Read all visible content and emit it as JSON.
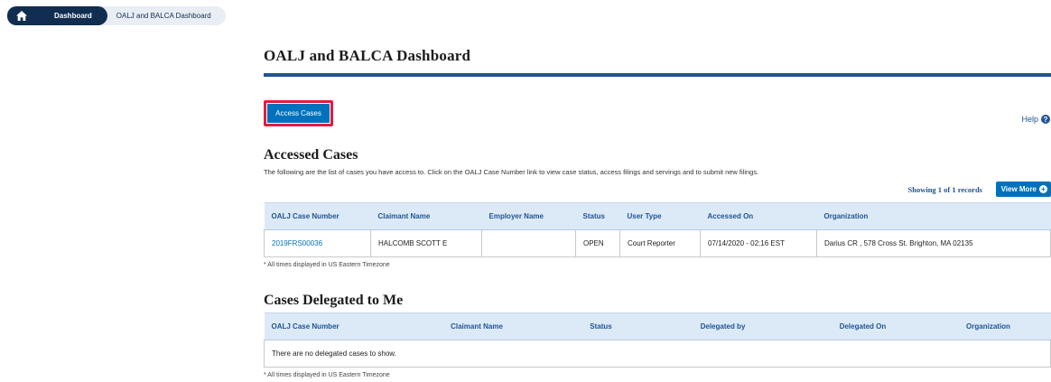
{
  "breadcrumb": {
    "home_icon": "home-icon",
    "dashboard": "Dashboard",
    "current": "OALJ and BALCA Dashboard"
  },
  "page_title": "OALJ and BALCA Dashboard",
  "help_label": "Help",
  "access_cases_button": "Access Cases",
  "accessed": {
    "title": "Accessed Cases",
    "description": "The following are the list of cases you have access to. Click on the OALJ Case Number link to view case status, access filings and servings and to submit new filings.",
    "showing": "Showing 1 of 1 records",
    "view_more": "View More",
    "columns": [
      "OALJ Case Number",
      "Claimant Name",
      "Employer Name",
      "Status",
      "User Type",
      "Accessed On",
      "Organization"
    ],
    "rows": [
      {
        "case_number": "2019FRS00036",
        "claimant": "HALCOMB SCOTT E",
        "employer": "",
        "status": "OPEN",
        "user_type": "Court Reporter",
        "accessed_on": "07/14/2020 - 02:16 EST",
        "organization": "Darius CR , 578 Cross St. Brighton, MA 02135"
      }
    ],
    "note": "* All times displayed in US Eastern Timezone"
  },
  "delegated": {
    "title": "Cases Delegated to Me",
    "columns": [
      "OALJ Case Number",
      "Claimant Name",
      "Status",
      "Delegated by",
      "Delegated On",
      "Organization"
    ],
    "empty": "There are no delegated cases to show.",
    "note": "* All times displayed in US Eastern Timezone"
  },
  "colors": {
    "navy": "#112e51",
    "blue": "#205493",
    "button": "#0071bc",
    "highlight": "#e31c3d",
    "header_bg": "#dceaf8"
  }
}
